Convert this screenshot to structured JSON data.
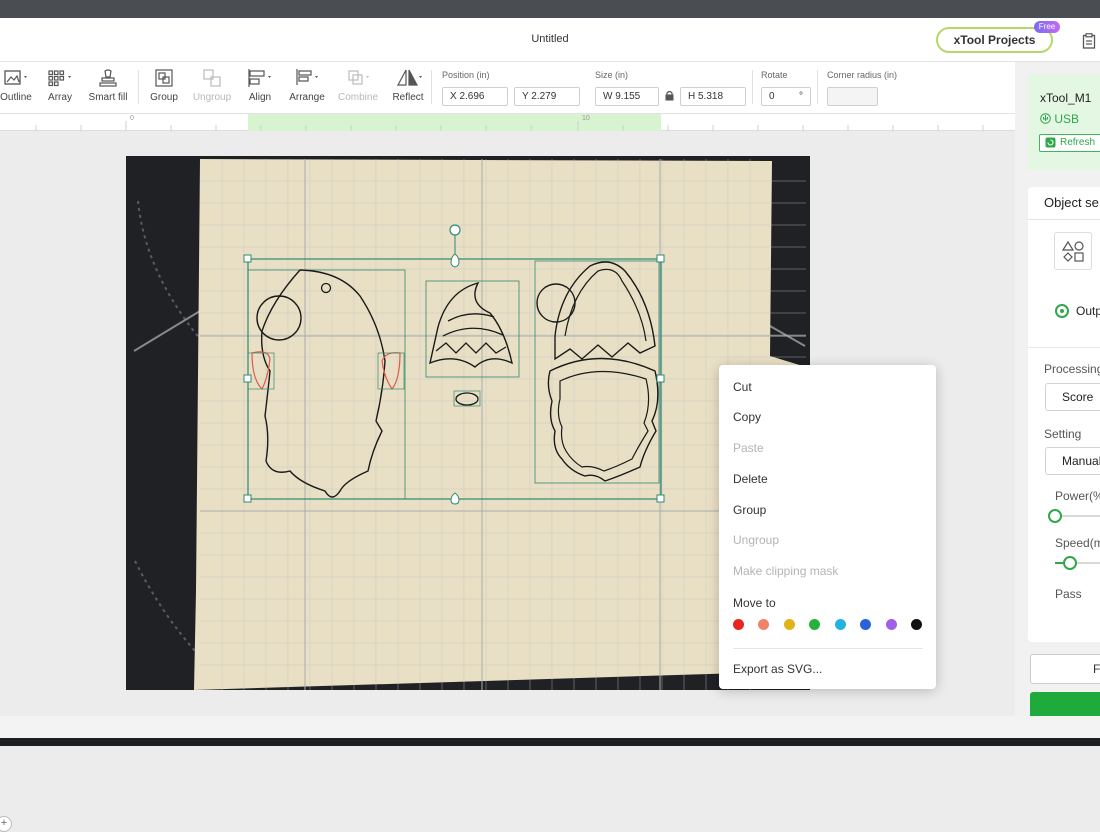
{
  "window": {
    "title": "Untitled"
  },
  "brand": {
    "label": "xTool Projects",
    "badge": "Free"
  },
  "toolbar": {
    "tools": [
      {
        "label": "Outline",
        "icon": "outline-icon",
        "enabled": true
      },
      {
        "label": "Array",
        "icon": "array-icon",
        "enabled": true
      },
      {
        "label": "Smart fill",
        "icon": "smart-fill-icon",
        "enabled": true
      },
      {
        "label": "Group",
        "icon": "group-icon",
        "enabled": true
      },
      {
        "label": "Ungroup",
        "icon": "ungroup-icon",
        "enabled": false
      },
      {
        "label": "Align",
        "icon": "align-icon",
        "enabled": true
      },
      {
        "label": "Arrange",
        "icon": "arrange-icon",
        "enabled": true
      },
      {
        "label": "Combine",
        "icon": "combine-icon",
        "enabled": false
      },
      {
        "label": "Reflect",
        "icon": "reflect-icon",
        "enabled": true
      }
    ],
    "position": {
      "label": "Position (in)",
      "x": "X 2.696",
      "y": "Y 2.279"
    },
    "size": {
      "label": "Size (in)",
      "w": "W 9.155",
      "h": "H 5.318",
      "lock_icon": "lock-icon"
    },
    "rotate": {
      "label": "Rotate",
      "value": "0",
      "unit": "°"
    },
    "corner_radius": {
      "label": "Corner radius (in)",
      "value": ""
    }
  },
  "ruler": {
    "marks": [
      "0",
      "10"
    ]
  },
  "context_menu": {
    "items": [
      {
        "label": "Cut",
        "enabled": true
      },
      {
        "label": "Copy",
        "enabled": true
      },
      {
        "label": "Paste",
        "enabled": false
      },
      {
        "label": "Delete",
        "enabled": true
      },
      {
        "label": "Group",
        "enabled": true
      },
      {
        "label": "Ungroup",
        "enabled": false
      },
      {
        "label": "Make clipping mask",
        "enabled": false
      }
    ],
    "move_to": "Move to",
    "colors": [
      "#e8261f",
      "#f0836a",
      "#e0b418",
      "#25b13a",
      "#23b3e0",
      "#2a62d8",
      "#a25fe6",
      "#111111"
    ],
    "export": "Export as SVG..."
  },
  "right_panel": {
    "device": {
      "name": "xTool_M1",
      "connection": "USB",
      "refresh": "Refresh"
    },
    "object_settings": "Object se",
    "output_label": "Outp",
    "processing_label": "Processing",
    "processing_value": "Score",
    "setting_label": "Setting",
    "setting_value": "Manual",
    "power_label": "Power(%",
    "speed_label": "Speed(m",
    "pass_label": "Pass",
    "power_level": 0.0,
    "speed_level": 0.25,
    "framing_button": "F"
  }
}
